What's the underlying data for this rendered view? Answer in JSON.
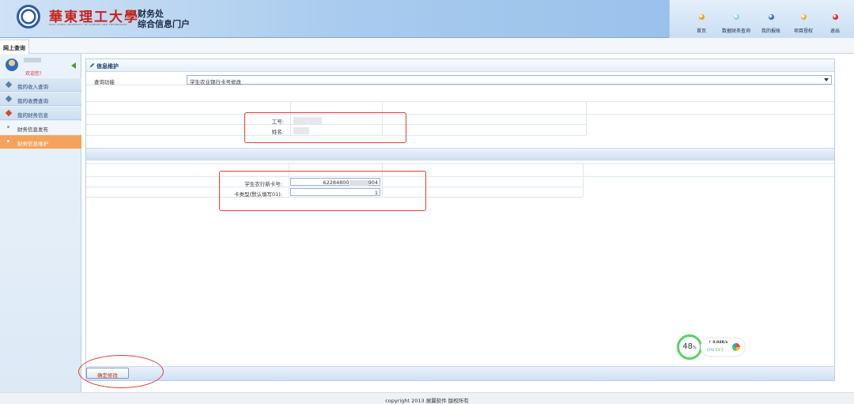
{
  "header": {
    "university_name": "華東理工大學",
    "university_name_en": "EAST CHINA UNIVERSITY OF SCIENCE AND TECHNOLOGY",
    "portal_line1": "财务处",
    "portal_line2": "综合信息门户",
    "nav": [
      {
        "label": "首页",
        "color": "#f0a020"
      },
      {
        "label": "数据财务查询",
        "color": "#8fd3f0"
      },
      {
        "label": "我的报账",
        "color": "#2f6fd4"
      },
      {
        "label": "项目授权",
        "color": "#f0b030"
      },
      {
        "label": "退出",
        "color": "#e02020"
      }
    ]
  },
  "tabs": {
    "active": "网上查询"
  },
  "sidebar": {
    "welcome": "欢迎您！",
    "items": [
      {
        "label": "我的收入查询"
      },
      {
        "label": "我的收费查询"
      },
      {
        "label": "我的财务信息"
      }
    ],
    "subitems": [
      {
        "label": "财务信息发布"
      },
      {
        "label": "财务信息维护"
      }
    ]
  },
  "panel": {
    "title": "信息维护",
    "query_label": "查询功能",
    "query_value": "学生农业银行卡号修改",
    "employee_id_label": "工号:",
    "name_label": "姓名:",
    "new_card_label": "学生农行新卡号:",
    "new_card_value": "62284800",
    "new_card_value_tail": "904",
    "card_type_label": "卡类型(默认填写01):",
    "card_type_value": "1",
    "submit_label": "确定修改"
  },
  "widget": {
    "percent": "48",
    "percent_unit": "%",
    "speed": "↑ 0.04K/s",
    "cpu_label": "CPU",
    "cpu_temp": "53°C"
  },
  "footer": {
    "copyright": "copyright 2013 展翼软件 版权所有"
  }
}
